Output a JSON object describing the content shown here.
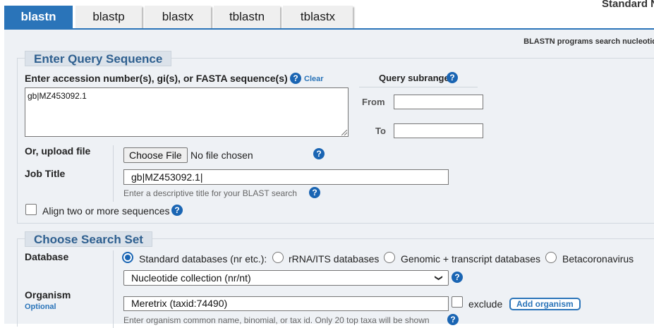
{
  "tabs": [
    {
      "label": "blastn",
      "active": true
    },
    {
      "label": "blastp",
      "active": false
    },
    {
      "label": "blastx",
      "active": false
    },
    {
      "label": "tblastn",
      "active": false
    },
    {
      "label": "tblastx",
      "active": false
    }
  ],
  "header": {
    "standard_text": "Standard N",
    "program_description": "BLASTN programs search nucleotid"
  },
  "query": {
    "legend": "Enter Query Sequence",
    "label": "Enter accession number(s), gi(s), or FASTA sequence(s)",
    "help": "?",
    "clear_label": "Clear",
    "sequence_value": "gb|MZ453092.1",
    "subrange_title": "Query subrange",
    "from_label": "From",
    "to_label": "To",
    "from_value": "",
    "to_value": "",
    "upload_label": "Or, upload file",
    "choose_file_label": "Choose File",
    "no_file_text": "No file chosen",
    "job_title_label": "Job Title",
    "job_title_value": "gb|MZ453092.1|",
    "job_title_hint": "Enter a descriptive title for your BLAST search",
    "align_label": "Align two or more sequences",
    "align_checked": false
  },
  "search_set": {
    "legend": "Choose Search Set",
    "database_label": "Database",
    "database_options": [
      {
        "label": "Standard databases (nr etc.):",
        "checked": true
      },
      {
        "label": "rRNA/ITS databases",
        "checked": false
      },
      {
        "label": "Genomic + transcript databases",
        "checked": false
      },
      {
        "label": "Betacoronavirus",
        "checked": false
      }
    ],
    "database_selected": "Nucleotide collection (nr/nt)",
    "organism_label": "Organism",
    "optional_label": "Optional",
    "organism_value": "Meretrix (taxid:74490)",
    "exclude_label": "exclude",
    "add_organism_label": "Add organism",
    "organism_hint": "Enter organism common name, binomial, or tax id. Only 20 top taxa will be shown"
  },
  "colors": {
    "accent": "#2a74b9",
    "panel_bg": "#eef1f5",
    "legend_text": "#2e5f8f",
    "help_icon": "#1a65b3"
  }
}
